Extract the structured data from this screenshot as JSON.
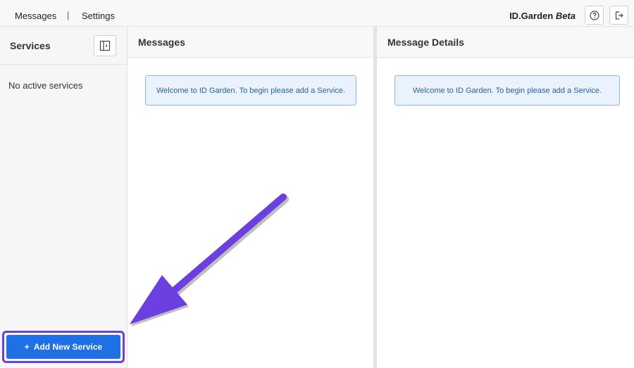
{
  "topbar": {
    "nav": [
      {
        "label": "Messages"
      },
      {
        "label": "Settings"
      }
    ],
    "separator": "|",
    "brand": {
      "name": "ID.Garden",
      "tag": "Beta"
    },
    "help_icon": "help-circle-icon",
    "logout_icon": "logout-icon"
  },
  "sidebar": {
    "title": "Services",
    "collapse_icon": "sidebar-collapse-icon",
    "empty_text": "No active services",
    "add_button": {
      "icon": "+",
      "label": "Add New Service"
    }
  },
  "messages_panel": {
    "title": "Messages",
    "notice": "Welcome to ID Garden. To begin please add a Service."
  },
  "details_panel": {
    "title": "Message Details",
    "notice": "Welcome to ID Garden. To begin please add a Service."
  },
  "colors": {
    "accent": "#1f6fe5",
    "highlight": "#6c3fe0",
    "notice_bg": "#eaf3fd",
    "notice_border": "#8bb8e8"
  }
}
